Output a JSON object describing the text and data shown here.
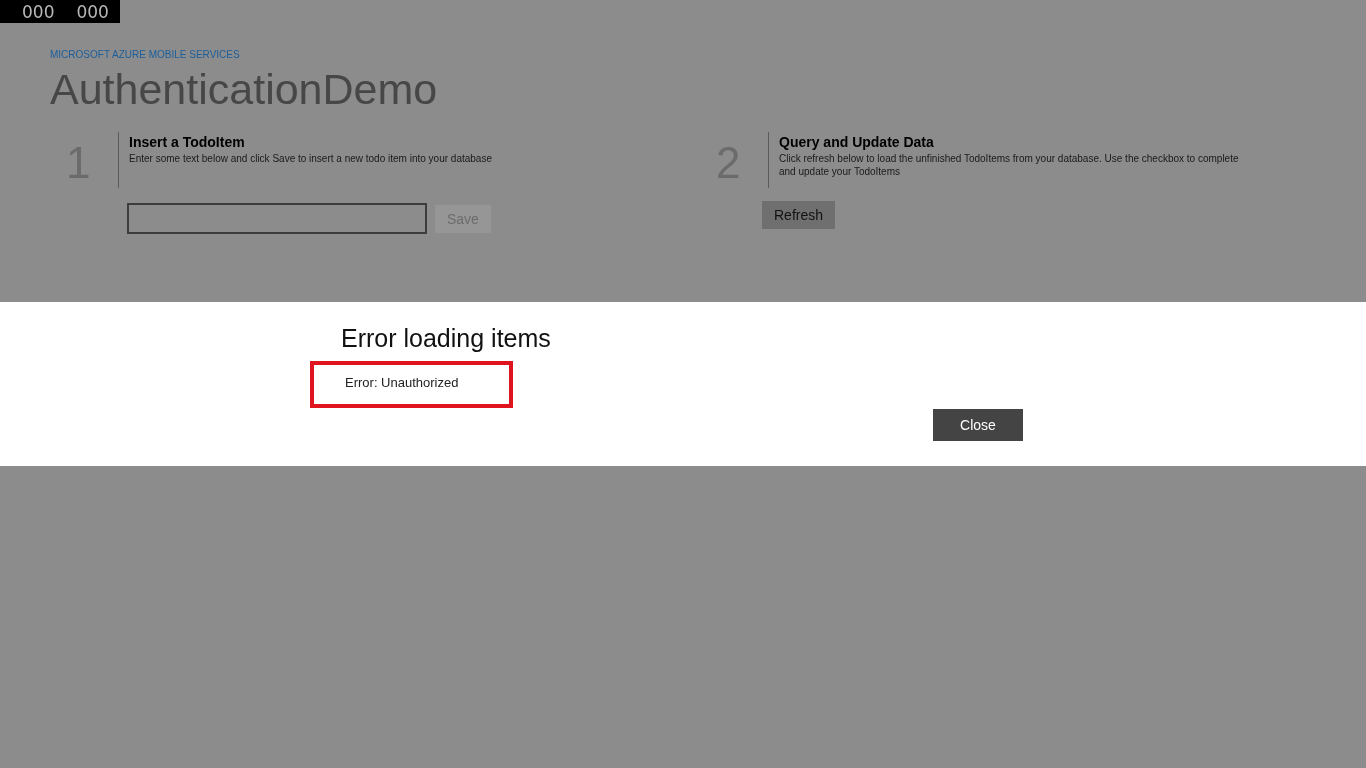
{
  "frame_counter": [
    "000",
    "000"
  ],
  "app": {
    "subtitle": "MICROSOFT AZURE MOBILE SERVICES",
    "title": "AuthenticationDemo"
  },
  "steps": [
    {
      "number": "1",
      "heading": "Insert a TodoItem",
      "description": "Enter some text below and click Save to insert a new todo item into your database",
      "kind": "insert",
      "button": {
        "label": "Save",
        "disabled": true
      }
    },
    {
      "number": "2",
      "heading": "Query and Update Data",
      "description": "Click refresh below to load the unfinished TodoItems from your database. Use the checkbox to complete and update your TodoItems",
      "kind": "query",
      "button": {
        "label": "Refresh",
        "disabled": false
      }
    }
  ],
  "dialog": {
    "title": "Error loading items",
    "message": "Error: Unauthorized",
    "message_highlighted": true,
    "button": "Close"
  }
}
